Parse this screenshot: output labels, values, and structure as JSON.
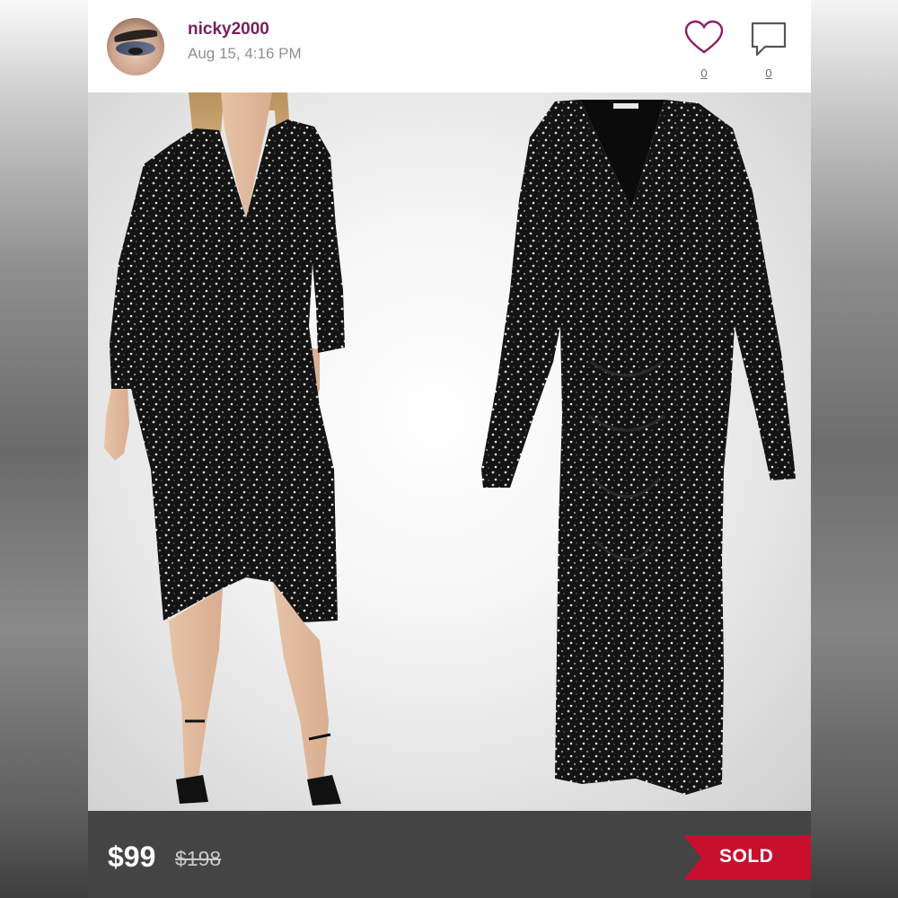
{
  "post": {
    "username": "nicky2000",
    "timestamp": "Aug 15, 4:16 PM",
    "likes": "0",
    "comments": "0"
  },
  "listing": {
    "price": "$99",
    "original_price": "$198",
    "status": "SOLD"
  },
  "photo": {
    "left_image": "model wearing black sequin ruched midi dress",
    "right_image": "black sequin long-sleeve ruched midi dress flat"
  },
  "icons": {
    "like": "heart-icon",
    "comment": "speech-bubble-icon"
  },
  "colors": {
    "username": "#7a1f5c",
    "like_icon": "#8a1f66",
    "footer": "#444444",
    "sold_ribbon": "#c8102e"
  }
}
